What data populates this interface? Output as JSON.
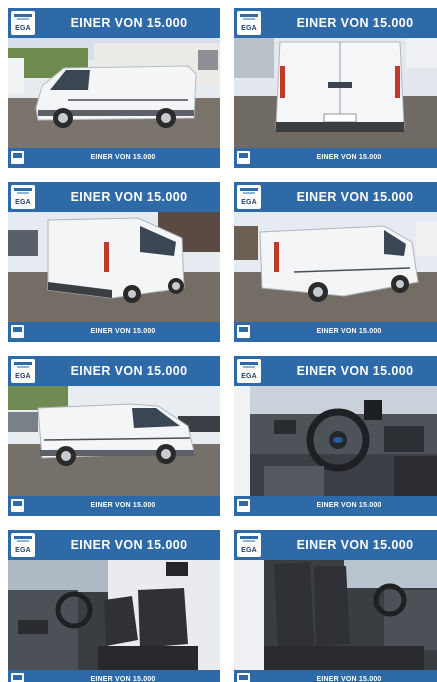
{
  "logo": {
    "text": "EGA"
  },
  "tiles": [
    {
      "headline": "EINER VON 15.000",
      "footer": "EINER VON 15.000",
      "photo": "van-left-side"
    },
    {
      "headline": "EINER VON 15.000",
      "footer": "EINER VON 15.000",
      "photo": "van-rear"
    },
    {
      "headline": "EINER VON 15.000",
      "footer": "EINER VON 15.000",
      "photo": "van-rear-quarter-left"
    },
    {
      "headline": "EINER VON 15.000",
      "footer": "EINER VON 15.000",
      "photo": "van-rear-quarter-right"
    },
    {
      "headline": "EINER VON 15.000",
      "footer": "EINER VON 15.000",
      "photo": "van-right-side"
    },
    {
      "headline": "EINER VON 15.000",
      "footer": "EINER VON 15.000",
      "photo": "cockpit-steering-wheel"
    },
    {
      "headline": "EINER VON 15.000",
      "footer": "EINER VON 15.000",
      "photo": "cabin-seats-from-right"
    },
    {
      "headline": "EINER VON 15.000",
      "footer": "EINER VON 15.000",
      "photo": "cabin-seats-from-left"
    }
  ],
  "colors": {
    "banner": "#2f6aa8",
    "van": "#f4f5f7",
    "sky": "#dfe6ee",
    "ground": "#6f6b67"
  }
}
